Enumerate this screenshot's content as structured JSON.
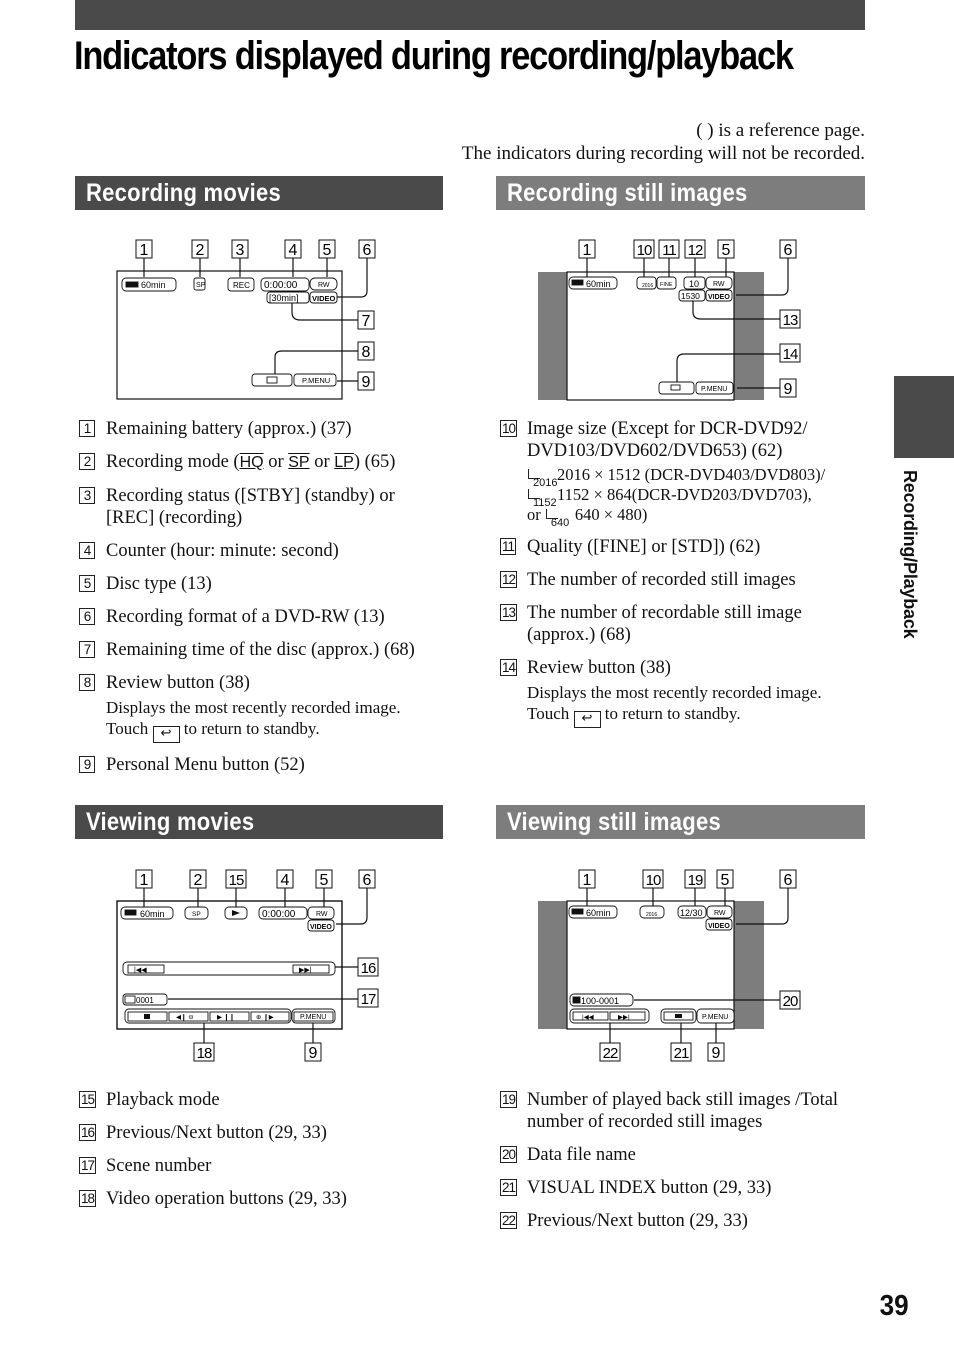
{
  "page": {
    "title": "Indicators displayed during recording/playback",
    "notes": [
      "( ) is a reference page.",
      "The indicators during recording will not be recorded."
    ],
    "side_tab_label": "Recording/Playback",
    "page_number": "39",
    "colors": {
      "dark_header": "#4a4a4a",
      "light_header": "#7d7d7d"
    }
  },
  "sections": {
    "recording_movies": {
      "title": "Recording movies",
      "screen": {
        "battery": "60min",
        "mode_icon": "SP",
        "status": "REC",
        "counter": "0:00:00",
        "disc": "RW",
        "format": "VIDEO",
        "remaining": "[30min]",
        "review_icon": "review-icon",
        "pmenu": "P.MENU"
      },
      "callouts": [
        "1",
        "2",
        "3",
        "4",
        "5",
        "6",
        "7",
        "8",
        "9"
      ],
      "items": [
        {
          "num": "1",
          "text": "Remaining battery (approx.) (37)"
        },
        {
          "num": "2",
          "text_before": "Recording mode  (",
          "hq": "HQ",
          "or1": " or ",
          "sp": "SP",
          "or2": " or ",
          "lp": "LP",
          "text_after": ") (65)"
        },
        {
          "num": "3",
          "text": "Recording status ([STBY] (standby) or [REC] (recording)"
        },
        {
          "num": "4",
          "text": "Counter (hour: minute: second)"
        },
        {
          "num": "5",
          "text": "Disc type (13)"
        },
        {
          "num": "6",
          "text": "Recording format of a DVD-RW (13)"
        },
        {
          "num": "7",
          "text": "Remaining time of the disc (approx.) (68)"
        },
        {
          "num": "8",
          "text": "Review button (38)",
          "sub1": "Displays the most recently recorded image.",
          "sub2a": "Touch ",
          "sub2b": " to return to standby."
        },
        {
          "num": "9",
          "text": "Personal Menu button (52)"
        }
      ]
    },
    "recording_still": {
      "title": "Recording still images",
      "screen": {
        "battery": "60min",
        "size": "2016",
        "quality": "FINE",
        "count": "10",
        "disc": "RW",
        "format": "VIDEO",
        "recordable": "1530",
        "pmenu": "P.MENU"
      },
      "callouts": [
        "1",
        "10",
        "11",
        "12",
        "5",
        "6",
        "13",
        "14",
        "9"
      ],
      "items": [
        {
          "num": "10",
          "text": "Image size (Except for DCR-DVD92/ DVD103/DVD602/DVD653) (62)",
          "sizes": [
            {
              "icon": "2016",
              "text": "2016 × 1512 (DCR-DVD403/DVD803)/"
            },
            {
              "icon": "1152",
              "text": "1152 × 864(DCR-DVD203/DVD703),"
            },
            {
              "prefix": "or ",
              "icon": "640",
              "text": "640 × 480)"
            }
          ]
        },
        {
          "num": "11",
          "text": "Quality ([FINE] or [STD]) (62)"
        },
        {
          "num": "12",
          "text": "The number of recorded still images"
        },
        {
          "num": "13",
          "text": "The number of recordable still image (approx.) (68)"
        },
        {
          "num": "14",
          "text": "Review button (38)",
          "sub1": "Displays the most recently recorded image.",
          "sub2a": "Touch ",
          "sub2b": " to return to standby."
        }
      ]
    },
    "viewing_movies": {
      "title": "Viewing movies",
      "screen": {
        "battery": "60min",
        "mode_icon": "SP",
        "counter": "0:00:00",
        "disc": "RW",
        "format": "VIDEO",
        "scene": "0001",
        "pmenu": "P.MENU"
      },
      "callouts": [
        "1",
        "2",
        "15",
        "4",
        "5",
        "6",
        "16",
        "17",
        "18",
        "9"
      ],
      "items": [
        {
          "num": "15",
          "text": "Playback mode"
        },
        {
          "num": "16",
          "text": "Previous/Next button (29, 33)"
        },
        {
          "num": "17",
          "text": "Scene number"
        },
        {
          "num": "18",
          "text": "Video operation buttons (29, 33)"
        }
      ]
    },
    "viewing_still": {
      "title": "Viewing still images",
      "screen": {
        "battery": "60min",
        "size": "2016",
        "played": "12/30",
        "disc": "RW",
        "format": "VIDEO",
        "file": "100-0001",
        "pmenu": "P.MENU"
      },
      "callouts": [
        "1",
        "10",
        "19",
        "5",
        "6",
        "20",
        "22",
        "21",
        "9"
      ],
      "items": [
        {
          "num": "19",
          "text": "Number of played back still images /Total number of recorded still images"
        },
        {
          "num": "20",
          "text": "Data file name"
        },
        {
          "num": "21",
          "text": "VISUAL INDEX button (29, 33)"
        },
        {
          "num": "22",
          "text": "Previous/Next button (29, 33)"
        }
      ]
    }
  }
}
